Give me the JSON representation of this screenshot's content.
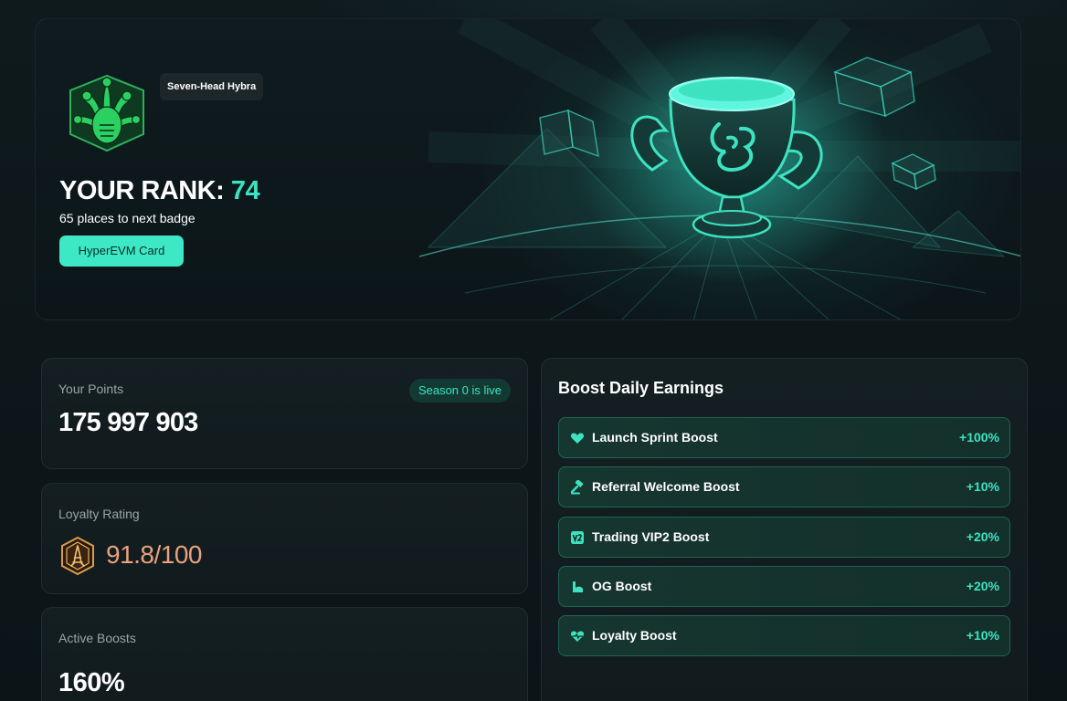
{
  "hero": {
    "badge_name": "Seven-Head Hybra",
    "rank_label": "YOUR RANK:",
    "rank_value": "74",
    "next_badge_text": "65 places to next badge",
    "card_button_label": "HyperEVM Card",
    "art_icon": "trophy-icon"
  },
  "points": {
    "label": "Your Points",
    "value": "175 997 903",
    "season_badge": "Season 0 is live"
  },
  "loyalty": {
    "label": "Loyalty Rating",
    "value": "91.8/100",
    "icon": "loyalty-badge-icon",
    "value_color": "#e8a27d"
  },
  "active_boosts": {
    "label": "Active Boosts",
    "value": "160%"
  },
  "boost_daily": {
    "title": "Boost Daily Earnings",
    "items": [
      {
        "label": "Launch Sprint Boost",
        "value": "+100%",
        "icon": "heart-icon"
      },
      {
        "label": "Referral Welcome Boost",
        "value": "+10%",
        "icon": "gavel-icon"
      },
      {
        "label": "Trading VIP2 Boost",
        "value": "+20%",
        "icon": "vip2-icon"
      },
      {
        "label": "OG Boost",
        "value": "+20%",
        "icon": "muscle-icon"
      },
      {
        "label": "Loyalty Boost",
        "value": "+10%",
        "icon": "heart-pulse-icon"
      }
    ]
  },
  "colors": {
    "accent": "#3de3c0",
    "button_bg": "#3de8c6",
    "background": "#0c1619"
  }
}
